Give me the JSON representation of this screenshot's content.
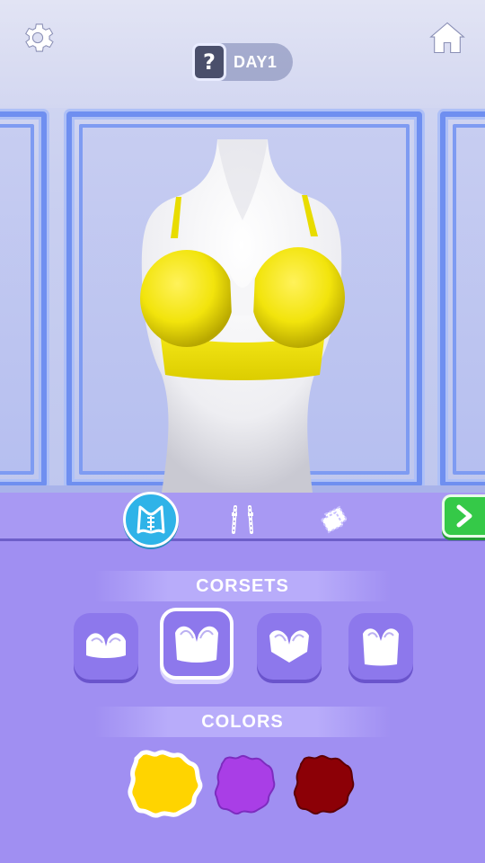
{
  "header": {
    "settings_icon": "gear-icon",
    "home_icon": "home-icon",
    "day_help_symbol": "?",
    "day_label": "DAY1"
  },
  "scene": {
    "garment_color": "#f2e40c",
    "mannequin_color": "#f4f4f6"
  },
  "tabs": [
    {
      "icon": "corset-icon",
      "active": true
    },
    {
      "icon": "straps-icon",
      "active": false
    },
    {
      "icon": "fabric-icon",
      "active": false
    }
  ],
  "next_icon": "chevron-right-icon",
  "sections": {
    "corsets_title": "CORSETS",
    "colors_title": "COLORS"
  },
  "corset_options": [
    {
      "name": "corset-style-1",
      "selected": false
    },
    {
      "name": "corset-style-2",
      "selected": true
    },
    {
      "name": "corset-style-3",
      "selected": false
    },
    {
      "name": "corset-style-4",
      "selected": false
    }
  ],
  "color_options": [
    {
      "color": "#ffd400",
      "selected": true
    },
    {
      "color": "#a93ee6",
      "selected": false
    },
    {
      "color": "#8c0006",
      "selected": false
    }
  ]
}
